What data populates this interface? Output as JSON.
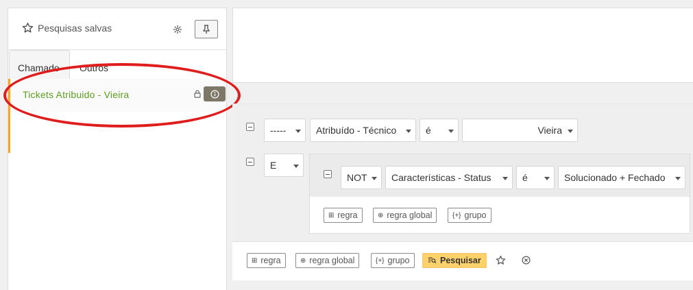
{
  "saved_searches": {
    "title": "Pesquisas salvas",
    "tabs": [
      {
        "label": "Chamado"
      },
      {
        "label": "Outros"
      }
    ],
    "items": [
      {
        "label": "Tickets Atribuido - Vieira"
      }
    ]
  },
  "criteria": {
    "row1": {
      "field_link": "-----",
      "field": "Atribuído - Técnico",
      "operator": "é",
      "value": "Vieira"
    },
    "row2": {
      "link": "E",
      "group": {
        "not": "NOT",
        "field": "Características - Status",
        "operator": "é",
        "value": "Solucionado + Fechado",
        "buttons": [
          "regra",
          "regra global",
          "grupo"
        ]
      }
    }
  },
  "footer": {
    "buttons": [
      "regra",
      "regra global",
      "grupo"
    ],
    "search_label": "Pesquisar"
  },
  "colors": {
    "accent": "#f5a623",
    "saved_item": "#5c9e1f",
    "annotation": "#e01d1d",
    "search_button": "#ffd16b"
  }
}
